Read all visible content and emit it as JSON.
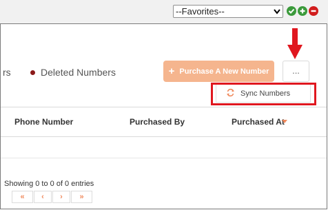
{
  "topbar": {
    "favorites_selected": "--Favorites--",
    "icons": [
      "check-circle-icon",
      "plus-circle-icon",
      "minus-circle-icon"
    ],
    "colors": {
      "check": "#3b9a3b",
      "plus": "#3b9a3b",
      "minus": "#d11d1d"
    }
  },
  "tabs": {
    "partial_label": "rs",
    "deleted_label": "Deleted Numbers"
  },
  "actions": {
    "purchase_label": "Purchase A New Number",
    "more_label": "...",
    "accent_color": "#f5b58e"
  },
  "dropdown": {
    "items": [
      {
        "label": "Sync Numbers",
        "icon": "sync-icon"
      }
    ],
    "highlight_color": "#e0171f"
  },
  "table": {
    "columns": [
      "Phone Number",
      "Purchased By",
      "Purchased At"
    ],
    "sorted_column": "Purchased At",
    "rows": []
  },
  "footer": {
    "info": "Showing 0 to 0 of 0 entries",
    "pager": [
      "«",
      "‹",
      "›",
      "»"
    ]
  }
}
